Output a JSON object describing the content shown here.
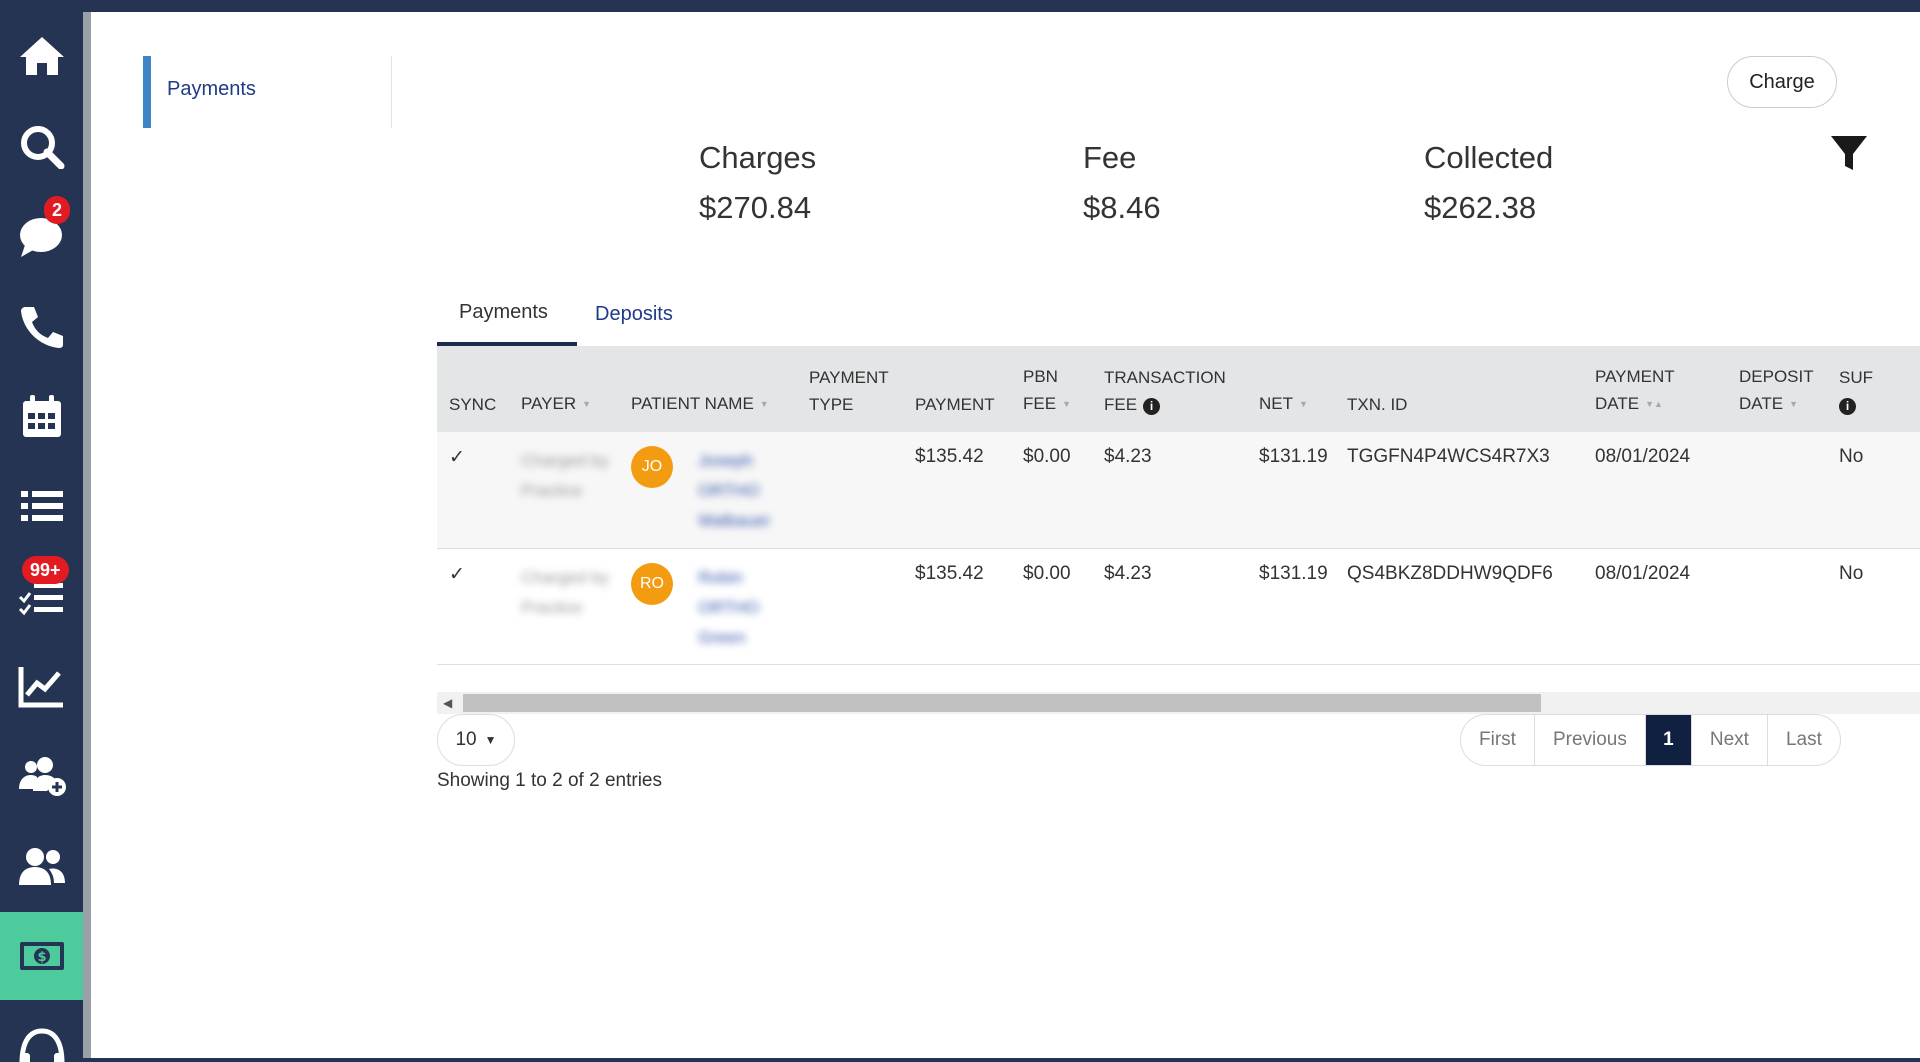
{
  "sidebar": {
    "items": [
      {
        "icon": "home-icon"
      },
      {
        "icon": "search-icon"
      },
      {
        "icon": "chat-icon",
        "badge": "2"
      },
      {
        "icon": "phone-icon"
      },
      {
        "icon": "calendar-icon"
      },
      {
        "icon": "list-icon"
      },
      {
        "icon": "checklist-icon",
        "badge": "99+"
      },
      {
        "icon": "chart-icon"
      },
      {
        "icon": "add-user-icon"
      },
      {
        "icon": "users-icon"
      },
      {
        "icon": "money-icon",
        "active": true
      },
      {
        "icon": "headset-icon"
      }
    ],
    "active_color": "#4ecb9c"
  },
  "left_nav": {
    "label": "Payments"
  },
  "charge_button": "Charge",
  "stats": {
    "charges_label": "Charges",
    "charges_value": "$270.84",
    "fee_label": "Fee",
    "fee_value": "$8.46",
    "collected_label": "Collected",
    "collected_value": "$262.38"
  },
  "tabs": {
    "payments": "Payments",
    "deposits": "Deposits"
  },
  "table": {
    "headers": {
      "sync": "SYNC",
      "payer": "PAYER",
      "patient_name": "PATIENT NAME",
      "payment_type_1": "PAYMENT",
      "payment_type_2": "TYPE",
      "payment": "PAYMENT",
      "pbn_fee_1": "PBN",
      "pbn_fee_2": "FEE",
      "transaction_fee_1": "TRANSACTION",
      "transaction_fee_2": "FEE",
      "net": "NET",
      "txn_id": "TXN. ID",
      "payment_date_1": "PAYMENT",
      "payment_date_2": "DATE",
      "deposit_date_1": "DEPOSIT",
      "deposit_date_2": "DATE",
      "sur": "SUF"
    },
    "rows": [
      {
        "sync": "✓",
        "payer": "Charged by Practice",
        "avatar": "JO",
        "patient_name": "Joseph ORTHO Walbauer",
        "payment_type": "",
        "payment": "$135.42",
        "pbn_fee": "$0.00",
        "transaction_fee": "$4.23",
        "net": "$131.19",
        "txn_id": "TGGFN4P4WCS4R7X3",
        "payment_date": "08/01/2024",
        "deposit_date": "",
        "sur": "No"
      },
      {
        "sync": "✓",
        "payer": "Charged by Practice",
        "avatar": "RO",
        "patient_name": "Robin ORTHO Green",
        "payment_type": "",
        "payment": "$135.42",
        "pbn_fee": "$0.00",
        "transaction_fee": "$4.23",
        "net": "$131.19",
        "txn_id": "QS4BKZ8DDHW9QDF6",
        "payment_date": "08/01/2024",
        "deposit_date": "",
        "sur": "No"
      }
    ]
  },
  "page_size": "10",
  "entries_text": "Showing 1 to 2 of 2 entries",
  "pagination": {
    "first": "First",
    "previous": "Previous",
    "current": "1",
    "next": "Next",
    "last": "Last"
  }
}
